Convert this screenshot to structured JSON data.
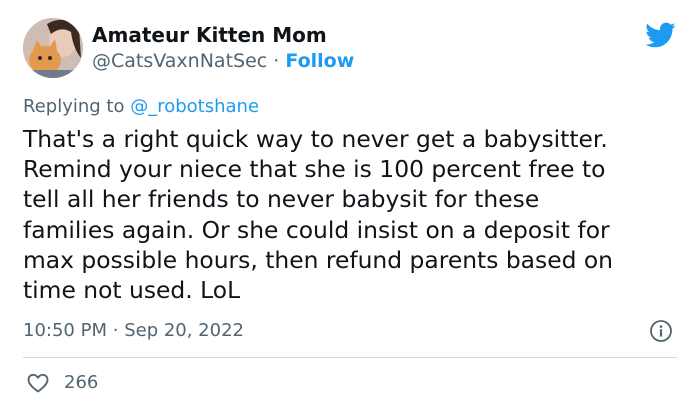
{
  "author": {
    "display_name": "Amateur Kitten Mom",
    "handle": "@CatsVaxnNatSec",
    "separator": "·",
    "follow_label": "Follow"
  },
  "reply": {
    "prefix": "Replying to",
    "target": "@_robotshane"
  },
  "tweet": {
    "lines": [
      "That's a right quick way to never get a babysitter.",
      "Remind your niece that she is 100 percent free to",
      "tell all her friends to never babysit for these",
      "families again. Or she could insist on a deposit for",
      "max possible hours, then refund parents based on",
      "time not used. LoL"
    ]
  },
  "meta": {
    "time": "10:50 PM",
    "separator": "·",
    "date": "Sep 20, 2022"
  },
  "engagement": {
    "likes": "266"
  },
  "colors": {
    "accent": "#1d9bf0",
    "secondary_text": "#536471",
    "primary_text": "#0f1419",
    "divider": "#cfd9de"
  },
  "icons": {
    "brand": "twitter-bird-icon",
    "info": "info-icon",
    "like": "heart-icon"
  }
}
